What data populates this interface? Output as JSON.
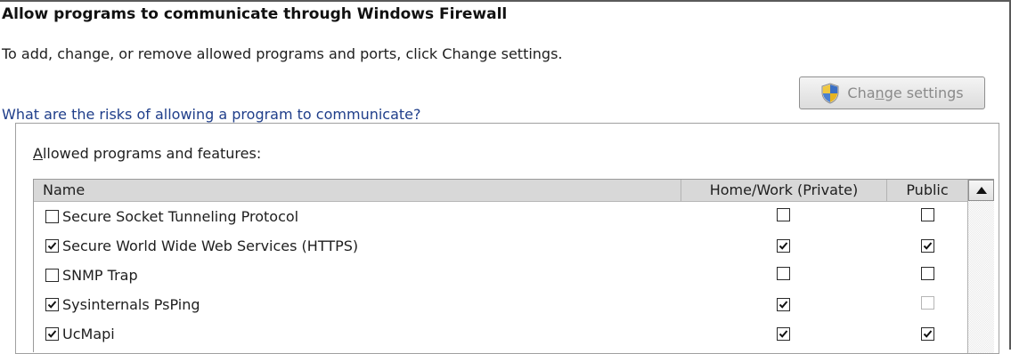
{
  "header": {
    "title": "Allow programs to communicate through Windows Firewall",
    "description": "To add, change, or remove allowed programs and ports, click Change settings.",
    "risk_link": "What are the risks of allowing a program to communicate?",
    "change_settings": {
      "pre": "Cha",
      "accel": "n",
      "post": "ge settings",
      "icon": "uac-shield-icon",
      "enabled": false
    }
  },
  "group": {
    "label_accel": "A",
    "label_rest": "llowed programs and features:"
  },
  "table": {
    "columns": {
      "name": "Name",
      "private": "Home/Work (Private)",
      "public": "Public"
    },
    "rows": [
      {
        "name": "Secure Socket Tunneling Protocol",
        "enabled": false,
        "private": false,
        "public": false,
        "public_disabled": false
      },
      {
        "name": "Secure World Wide Web Services (HTTPS)",
        "enabled": true,
        "private": true,
        "public": true,
        "public_disabled": false
      },
      {
        "name": "SNMP Trap",
        "enabled": false,
        "private": false,
        "public": false,
        "public_disabled": false
      },
      {
        "name": "Sysinternals PsPing",
        "enabled": true,
        "private": true,
        "public": false,
        "public_disabled": true
      },
      {
        "name": "UcMapi",
        "enabled": true,
        "private": true,
        "public": true,
        "public_disabled": false
      }
    ]
  },
  "colors": {
    "link": "#1f3e8a",
    "header_bg": "#d8d8d8",
    "disabled_text": "#8a8a8a"
  }
}
